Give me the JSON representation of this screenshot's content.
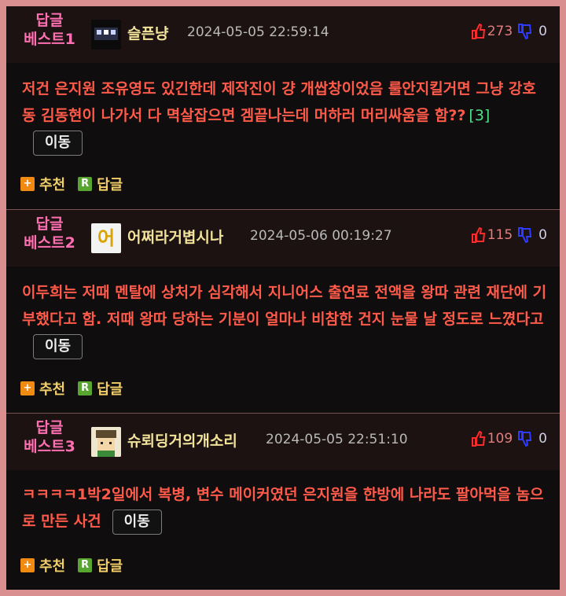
{
  "posts": [
    {
      "best_line1": "답글",
      "best_line2": "베스트1",
      "nickname": "슬픈냥",
      "date": "2024-05-05 22:59:14",
      "up": "273",
      "down": "0",
      "body": "저건 은지원 조유영도 있긴한데 제작진이 걍 개쌉창이었음 룰안지킬거면 그냥 강호동 김동현이 나가서 다 멱살잡으면 겜끝나는데 머하러 머리싸움을 함??",
      "ref": "[3]",
      "move_label": "이동",
      "recommend_label": "추천",
      "reply_label": "답글"
    },
    {
      "best_line1": "답글",
      "best_line2": "베스트2",
      "nickname": "어쩌라거볍시나",
      "avatar_char": "어",
      "date": "2024-05-06 00:19:27",
      "up": "115",
      "down": "0",
      "body": "이두희는 저때 멘탈에 상처가 심각해서 지니어스 출연료 전액을 왕따 관련 재단에 기부했다고 함. 저때 왕따 당하는 기분이 얼마나 비참한 건지 눈물 날 정도로 느꼈다고",
      "move_label": "이동",
      "recommend_label": "추천",
      "reply_label": "답글"
    },
    {
      "best_line1": "답글",
      "best_line2": "베스트3",
      "nickname": "슈뢰딩거의개소리",
      "date": "2024-05-05 22:51:10",
      "up": "109",
      "down": "0",
      "body": "ㅋㅋㅋㅋ1박2일에서 복병, 변수 메이커였던 은지원을 한방에 나라도 팔아먹을 놈으로 만든 사건",
      "move_label": "이동",
      "recommend_label": "추천",
      "reply_label": "답글"
    }
  ],
  "colors": {
    "best": "#ff6fb1",
    "nickname": "#f2e39a",
    "body": "#ff5a4a",
    "up": "#e37d7d",
    "down_icon": "#2e3cff",
    "up_icon": "#ff2a2a"
  }
}
